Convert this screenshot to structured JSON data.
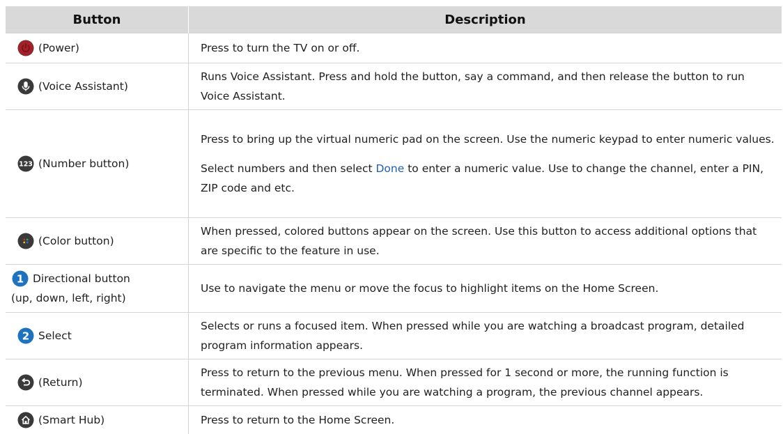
{
  "table": {
    "headers": {
      "button": "Button",
      "description": "Description"
    },
    "rows": [
      {
        "icon": "power-icon",
        "icon_color": "#a3222a",
        "label": "(Power)",
        "desc": [
          "Press to turn the TV on or off."
        ]
      },
      {
        "icon": "microphone-icon",
        "icon_color": "#3a3a3a",
        "label": "(Voice Assistant)",
        "desc": [
          "Runs Voice Assistant. Press and hold the button, say a command, and then release the button to run Voice Assistant."
        ]
      },
      {
        "icon": "number-123-icon",
        "icon_color": "#3a3a3a",
        "label": "(Number button)",
        "desc": [
          "Press to bring up the virtual numeric pad on the screen. Use the numeric keypad to enter numeric values."
        ],
        "desc2": {
          "before": "Select numbers and then select ",
          "highlight": "Done",
          "after": " to enter a numeric value. Use to change the channel, enter a PIN, ZIP code and etc."
        }
      },
      {
        "icon": "color-dots-icon",
        "icon_color": "#3a3a3a",
        "label": "(Color button)",
        "desc": [
          "When pressed, colored buttons appear on the screen. Use this button to access additional options that are specific to the feature in use."
        ]
      },
      {
        "icon": "number-1-icon",
        "icon_color": "#1e73be",
        "icon_text": "1",
        "label": "Directional button",
        "label2": "(up, down, left, right)",
        "desc": [
          "Use to navigate the menu or move the focus to highlight items on the Home Screen."
        ]
      },
      {
        "icon": "number-2-icon",
        "icon_color": "#1e73be",
        "icon_text": "2",
        "label": "Select",
        "desc": [
          "Selects or runs a focused item. When pressed while you are watching a broadcast program, detailed program information appears."
        ]
      },
      {
        "icon": "return-arrow-icon",
        "icon_color": "#3a3a3a",
        "label": "(Return)",
        "desc": [
          "Press to return to the previous menu. When pressed for 1 second or more, the running function is terminated. When pressed while you are watching a program, the previous channel appears."
        ]
      },
      {
        "icon": "home-icon",
        "icon_color": "#3a3a3a",
        "label": "(Smart Hub)",
        "desc": [
          "Press to return to the Home Screen."
        ]
      }
    ]
  }
}
